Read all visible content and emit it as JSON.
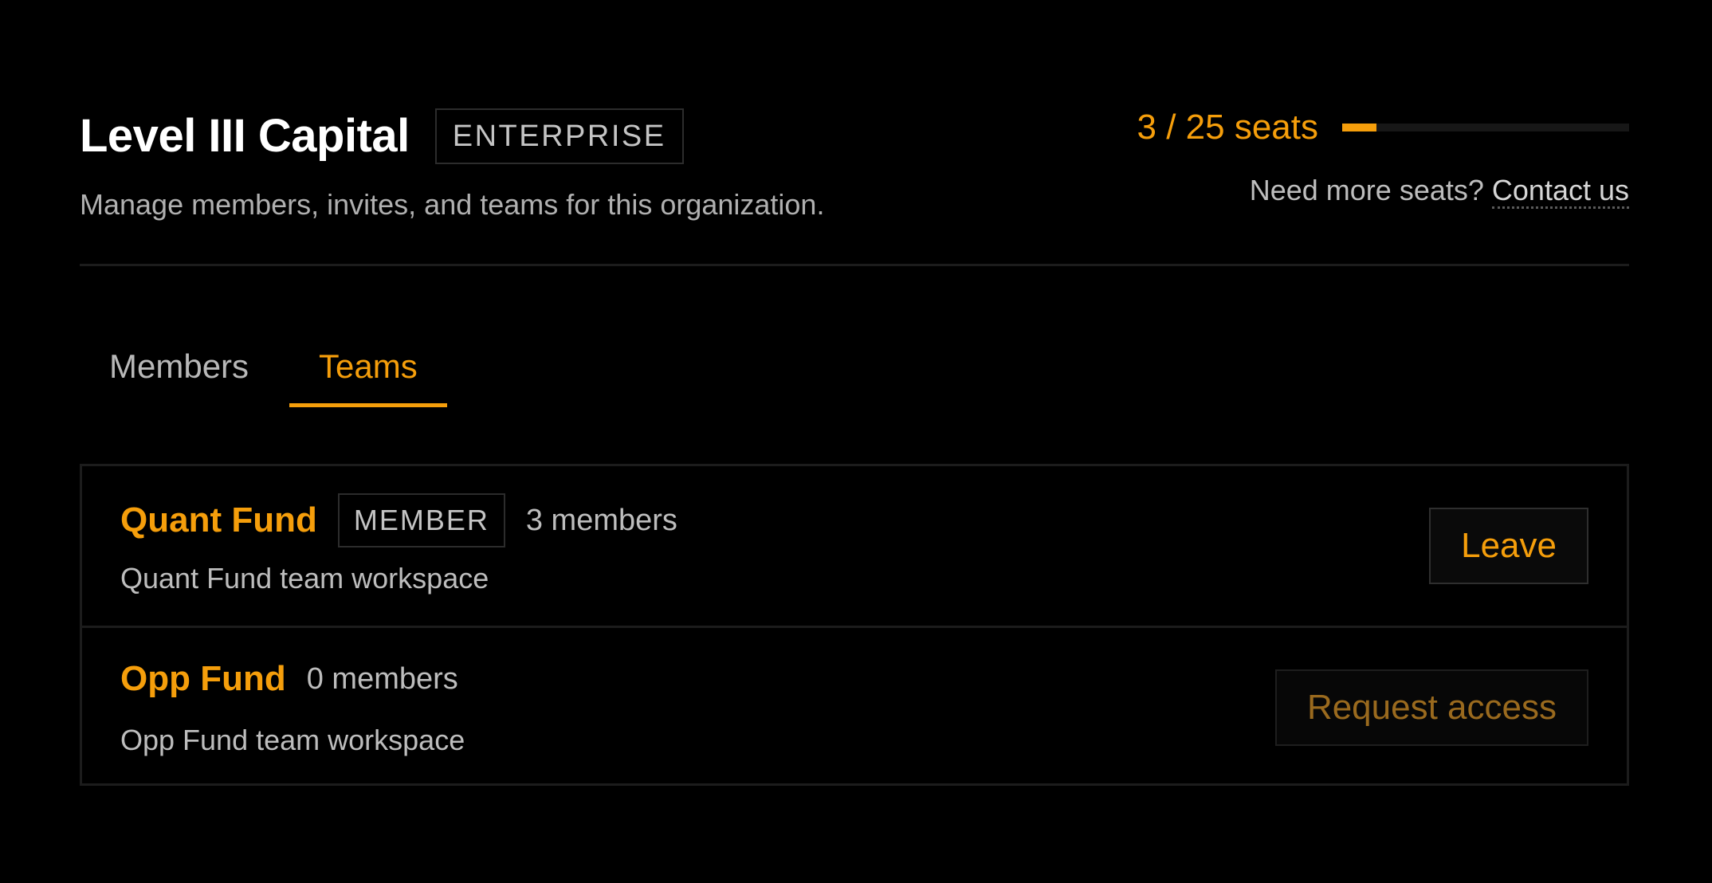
{
  "org": {
    "name": "Level III Capital",
    "plan": "ENTERPRISE",
    "subtitle": "Manage members, invites, and teams for this organization."
  },
  "seats": {
    "label": "3 / 25 seats",
    "used": 3,
    "total": 25,
    "help_text": "Need more seats?",
    "contact_label": "Contact us"
  },
  "tabs": [
    {
      "label": "Members",
      "active": false
    },
    {
      "label": "Teams",
      "active": true
    }
  ],
  "teams": [
    {
      "name": "Quant Fund",
      "role": "MEMBER",
      "members": "3 members",
      "description": "Quant Fund team workspace",
      "action": "Leave"
    },
    {
      "name": "Opp Fund",
      "role": "",
      "members": "0 members",
      "description": "Opp Fund team workspace",
      "action": "Request access"
    }
  ],
  "colors": {
    "accent": "#f59e0b",
    "background": "#000000",
    "muted_accent": "#9a6a1e"
  }
}
